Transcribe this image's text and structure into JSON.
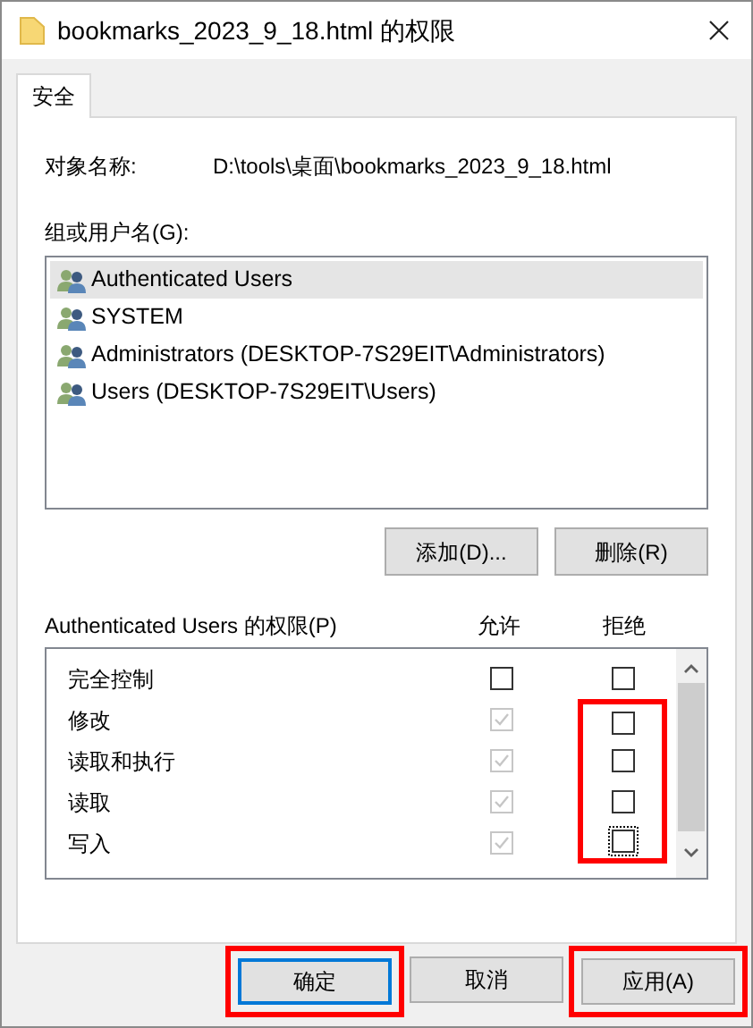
{
  "window": {
    "title": "bookmarks_2023_9_18.html 的权限"
  },
  "tabs": [
    {
      "label": "安全",
      "selected": true
    }
  ],
  "object_name": {
    "label": "对象名称:",
    "value": "D:\\tools\\桌面\\bookmarks_2023_9_18.html"
  },
  "users": {
    "label": "组或用户名(G):",
    "items": [
      {
        "name": "Authenticated Users",
        "selected": true
      },
      {
        "name": "SYSTEM",
        "selected": false
      },
      {
        "name": "Administrators (DESKTOP-7S29EIT\\Administrators)",
        "selected": false
      },
      {
        "name": "Users (DESKTOP-7S29EIT\\Users)",
        "selected": false
      }
    ],
    "buttons": [
      "添加(D)...",
      "删除(R)"
    ]
  },
  "permissions": {
    "label": "Authenticated Users 的权限(P)",
    "allow_header": "允许",
    "deny_header": "拒绝",
    "rows": [
      {
        "name": "完全控制",
        "allow": false,
        "allow_disabled": false,
        "deny": false,
        "deny_focused": false,
        "deny_highlighted": false
      },
      {
        "name": "修改",
        "allow": true,
        "allow_disabled": true,
        "deny": false,
        "deny_focused": false,
        "deny_highlighted": true
      },
      {
        "name": "读取和执行",
        "allow": true,
        "allow_disabled": true,
        "deny": false,
        "deny_focused": false,
        "deny_highlighted": true
      },
      {
        "name": "读取",
        "allow": true,
        "allow_disabled": true,
        "deny": false,
        "deny_focused": false,
        "deny_highlighted": true
      },
      {
        "name": "写入",
        "allow": true,
        "allow_disabled": true,
        "deny": false,
        "deny_focused": true,
        "deny_highlighted": true
      }
    ]
  },
  "dialog_buttons": [
    {
      "label": "确定",
      "default": true,
      "highlighted": true
    },
    {
      "label": "取消",
      "default": false,
      "highlighted": false
    },
    {
      "label": "应用(A)",
      "default": false,
      "highlighted": true
    }
  ]
}
